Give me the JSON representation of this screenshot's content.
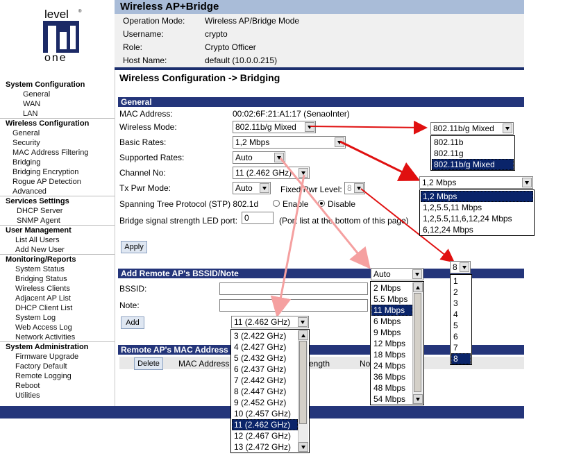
{
  "logo": {
    "top": "level",
    "bottom": "one"
  },
  "sidebar": {
    "sections": [
      {
        "title": "System Configuration",
        "items": [
          "General",
          "WAN",
          "LAN"
        ]
      },
      {
        "title": "Wireless Configuration",
        "items": [
          "General",
          "Security",
          "MAC Address Filtering",
          "Bridging",
          "Bridging Encryption",
          "Rogue AP Detection",
          "Advanced"
        ]
      },
      {
        "title": "Services Settings",
        "items": [
          "DHCP Server",
          "SNMP Agent"
        ]
      },
      {
        "title": "User Management",
        "items": [
          "List All Users",
          "Add New User"
        ]
      },
      {
        "title": "Monitoring/Reports",
        "items": [
          "System Status",
          "Bridging Status",
          "Wireless Clients",
          "Adjacent AP List",
          "DHCP Client List",
          "System Log",
          "Web Access Log",
          "Network Activities"
        ]
      },
      {
        "title": "System Administration",
        "items": [
          "Firmware Upgrade",
          "Factory Default",
          "Remote Logging",
          "Reboot",
          "Utilities"
        ]
      }
    ]
  },
  "header": {
    "title": "Wireless AP+Bridge",
    "info": [
      {
        "label": "Operation Mode:",
        "value": "Wireless AP/Bridge Mode"
      },
      {
        "label": "Username:",
        "value": "crypto"
      },
      {
        "label": "Role:",
        "value": "Crypto Officer"
      },
      {
        "label": "Host Name:",
        "value": "default (10.0.0.215)"
      }
    ]
  },
  "page_title": "Wireless Configuration -> Bridging",
  "general": {
    "section_title": "General",
    "mac_label": "MAC Address:",
    "mac_value": "00:02:6F:21:A1:17 (SenaoInter)",
    "mode_label": "Wireless Mode:",
    "mode_value": "802.11b/g Mixed",
    "basic_label": "Basic Rates:",
    "basic_value": "1,2 Mbps",
    "supported_label": "Supported Rates:",
    "supported_value": "Auto",
    "channel_label": "Channel No:",
    "channel_value": "11 (2.462 GHz)",
    "txpwr_label": "Tx Pwr Mode:",
    "txpwr_value": "Auto",
    "fixed_label": "Fixed Pwr Level:",
    "fixed_value": "8",
    "stp_label": "Spanning Tree Protocol (STP) 802.1d",
    "stp_enable": "Enable",
    "stp_disable": "Disable",
    "led_label": "Bridge signal strength LED port:",
    "led_value": "0",
    "led_note": "(Port list at the bottom of this page)",
    "apply": "Apply"
  },
  "remote": {
    "section_title": "Add Remote AP's BSSID/Note",
    "bssid_label": "BSSID:",
    "note_label": "Note:",
    "add": "Add"
  },
  "mac_table": {
    "section_title": "Remote AP's MAC Address",
    "delete": "Delete",
    "col_mac": "MAC Address",
    "col_strength": "ength",
    "col_no": "No"
  },
  "popups": {
    "mode": {
      "value": "802.11b/g Mixed",
      "options": [
        "802.11b",
        "802.11g",
        "802.11b/g Mixed"
      ],
      "selected": 2
    },
    "basic": {
      "value": "1,2 Mbps",
      "options": [
        "1,2 Mbps",
        "1,2,5.5,11 Mbps",
        "1,2,5.5,11,6,12,24 Mbps",
        "6,12,24 Mbps"
      ],
      "selected": 0
    },
    "fixed": {
      "value": "8",
      "options": [
        "1",
        "2",
        "3",
        "4",
        "5",
        "6",
        "7",
        "8"
      ],
      "selected": 7
    },
    "supported": {
      "value": "Auto",
      "options": [
        "2 Mbps",
        "5.5 Mbps",
        "11 Mbps",
        "6 Mbps",
        "9 Mbps",
        "12 Mbps",
        "18 Mbps",
        "24 Mbps",
        "36 Mbps",
        "48 Mbps",
        "54 Mbps"
      ],
      "selected": 2
    },
    "channel": {
      "value": "11 (2.462 GHz)",
      "options": [
        "3 (2.422 GHz)",
        "4 (2.427 GHz)",
        "5 (2.432 GHz)",
        "6 (2.437 GHz)",
        "7 (2.442 GHz)",
        "8 (2.447 GHz)",
        "9 (2.452 GHz)",
        "10 (2.457 GHz)",
        "11 (2.462 GHz)",
        "12 (2.467 GHz)",
        "13 (2.472 GHz)"
      ],
      "selected": 8
    }
  },
  "colors": {
    "nav_dark": "#24357a",
    "header_light": "#a9bcd8",
    "highlight": "#0a246a",
    "arrow_red": "#e01010",
    "arrow_pink": "#f5a0a0"
  }
}
